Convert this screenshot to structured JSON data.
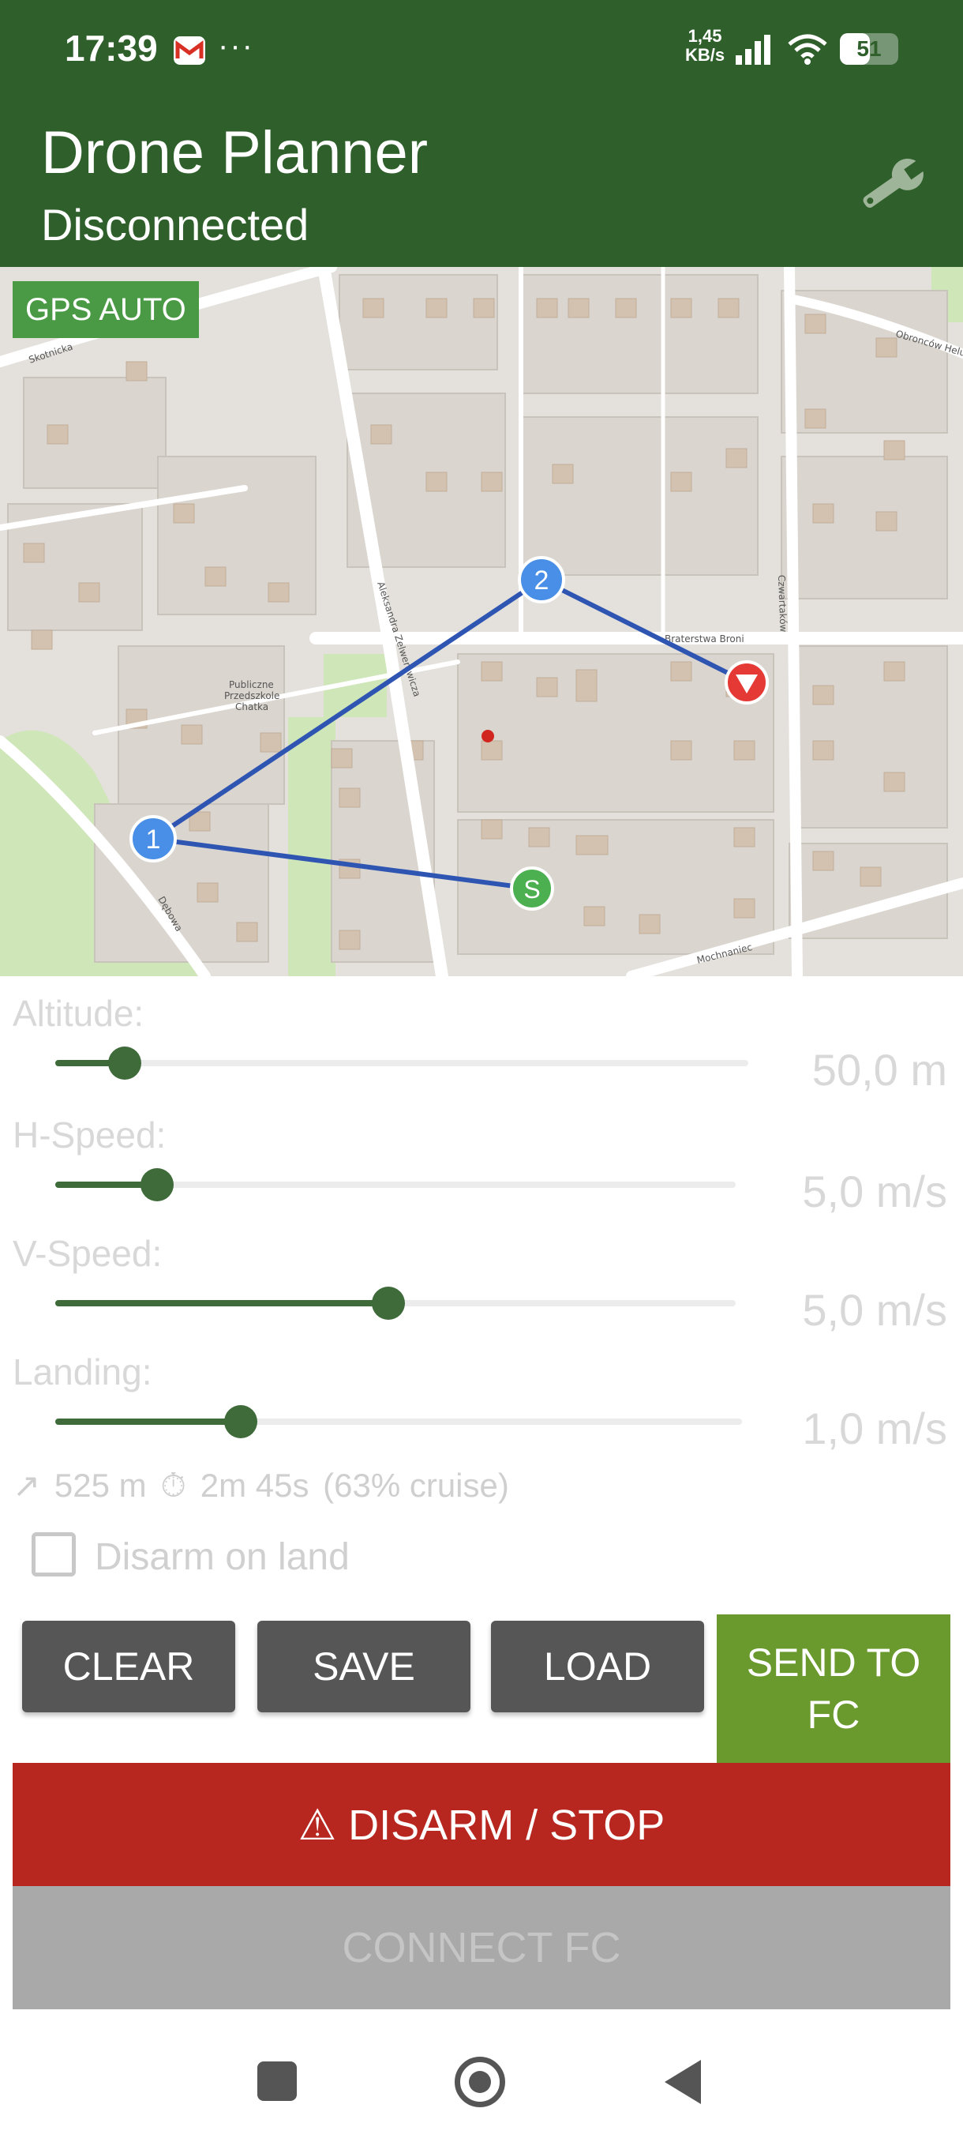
{
  "status_bar": {
    "time": "17:39",
    "net_speed_value": "1,45",
    "net_speed_unit": "KB/s",
    "battery_level": "51",
    "icons": [
      "gmail-icon",
      "more-dots-icon",
      "signal-icon",
      "wifi-icon",
      "battery-icon"
    ]
  },
  "header": {
    "title": "Drone Planner",
    "subtitle": "Disconnected",
    "settings_icon": "wrench-icon",
    "background_color": "#2f5f2b"
  },
  "map": {
    "gps_badge": "GPS AUTO",
    "waypoints": [
      {
        "label": "S",
        "color": "#4caf50"
      },
      {
        "label": "1",
        "color": "#4a8fe7"
      },
      {
        "label": "2",
        "color": "#4a8fe7"
      },
      {
        "label": "▼",
        "color": "#e53935"
      }
    ],
    "street_labels": [
      "Skotnicka",
      "Aleksandra Zelwerowicza",
      "Braterstwa Broni",
      "Czwartaków",
      "Dębowa",
      "Mochnaniec",
      "Obronców Helu"
    ],
    "poi_label": [
      "Publiczne",
      "Przedszkole",
      "Chatka"
    ]
  },
  "controls": {
    "altitude": {
      "label": "Altitude:",
      "value": "50,0 m",
      "level": 0.1
    },
    "hspeed": {
      "label": "H-Speed:",
      "value": "5,0 m/s",
      "level": 0.15
    },
    "vspeed": {
      "label": "V-Speed:",
      "value": "5,0 m/s",
      "level": 0.49
    },
    "landing": {
      "label": "Landing:",
      "value": "1,0 m/s",
      "level": 0.27
    }
  },
  "stats": {
    "distance": "525 m",
    "time": "2m 45s",
    "cruise": "(63% cruise)",
    "distance_icon": "arrow-up-right-icon",
    "time_icon": "timer-icon"
  },
  "disarm_checkbox": {
    "label": "Disarm on land",
    "checked": false
  },
  "buttons": {
    "clear": "CLEAR",
    "save": "SAVE",
    "load": "LOAD",
    "send_line1": "SEND TO",
    "send_line2": "FC",
    "disarm": "⚠ DISARM / STOP",
    "connect": "CONNECT FC"
  },
  "colors": {
    "accent_green": "#6a9a2e",
    "slider_green": "#3f6b3a",
    "danger_red": "#b7261f",
    "disabled_gray": "#a9a9a9"
  }
}
